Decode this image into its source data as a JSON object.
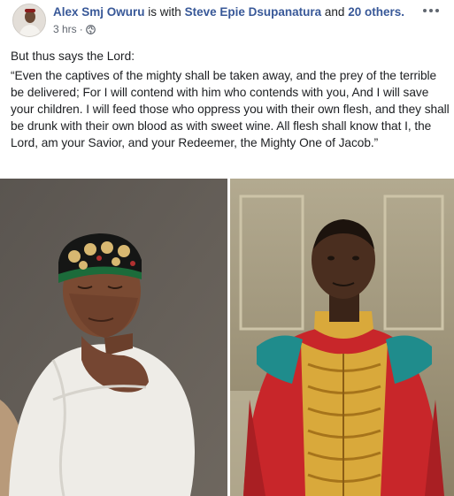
{
  "post": {
    "author": "Alex Smj Owuru",
    "with_text": "is with",
    "with_name": "Steve Epie Dsupanatura",
    "and_text": "and",
    "others": "20 others.",
    "time": "3 hrs",
    "separator": "·",
    "privacy_icon": "globe-icon",
    "more_icon": "more-options-icon",
    "intro": "But thus says the Lord:",
    "quote": "“Even the captives of the mighty shall be taken away, and the prey of the terrible be delivered; For I will contend with him who contends with you, And I will save your children. I will feed those who oppress you with their own flesh, and they shall be drunk with their own blood as with sweet wine. All flesh shall know that I, the Lord, am your Savior, and your Redeemer, the Mighty One of Jacob.”"
  },
  "colors": {
    "link": "#385898",
    "text": "#1c1e21",
    "meta": "#616770"
  }
}
